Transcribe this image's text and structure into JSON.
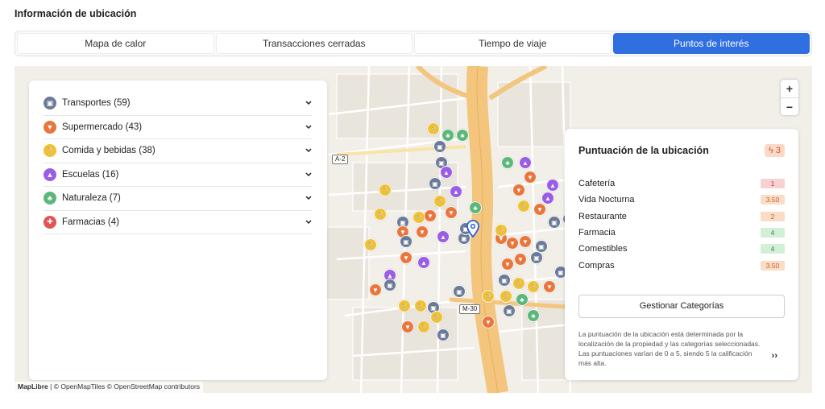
{
  "section_title": "Información de ubicación",
  "tabs": [
    {
      "label": "Mapa de calor",
      "active": false
    },
    {
      "label": "Transacciones cerradas",
      "active": false
    },
    {
      "label": "Tiempo de viaje",
      "active": false
    },
    {
      "label": "Puntos de interés",
      "active": true
    }
  ],
  "categories": [
    {
      "label": "Transportes (59)",
      "icon": "bus-icon",
      "color": "#6b7a99"
    },
    {
      "label": "Supermercado (43)",
      "icon": "cart-icon",
      "color": "#e8763d"
    },
    {
      "label": "Comida y bebidas (38)",
      "icon": "fork-knife-icon",
      "color": "#f2c12e"
    },
    {
      "label": "Escuelas (16)",
      "icon": "graduation-cap-icon",
      "color": "#9b5de5"
    },
    {
      "label": "Naturaleza (7)",
      "icon": "tree-icon",
      "color": "#5cb87a"
    },
    {
      "label": "Farmacias (4)",
      "icon": "medkit-icon",
      "color": "#e25555"
    }
  ],
  "map": {
    "road_labels": [
      "A-2",
      "M-30"
    ],
    "zoom_in": "+",
    "zoom_out": "−",
    "attribution_brand": "MapLibre",
    "attribution_rest": " | © OpenMapTiles © OpenStreetMap contributors"
  },
  "score": {
    "title": "Puntuación de la ubicación",
    "overall": "3",
    "rows": [
      {
        "label": "Cafetería",
        "value": "1",
        "bg": "#f8d2d2",
        "fg": "#c0392b"
      },
      {
        "label": "Vida Nocturna",
        "value": "3.50",
        "bg": "#fbdcc8",
        "fg": "#c2622d"
      },
      {
        "label": "Restaurante",
        "value": "2",
        "bg": "#fbdcc8",
        "fg": "#c2622d"
      },
      {
        "label": "Farmacia",
        "value": "4",
        "bg": "#d3efd6",
        "fg": "#2e8b47"
      },
      {
        "label": "Comestibles",
        "value": "4",
        "bg": "#d3efd6",
        "fg": "#2e8b47"
      },
      {
        "label": "Compras",
        "value": "3.50",
        "bg": "#fbdcc8",
        "fg": "#c2622d"
      }
    ],
    "manage_label": "Gestionar Categorías",
    "description": "La puntuación de la ubicación está determinada por la localización de la propiedad y las categorías seleccionadas. Las puntuaciones varían de 0 a 5, siendo 5 la calificación más alta.",
    "more_label": "››"
  }
}
